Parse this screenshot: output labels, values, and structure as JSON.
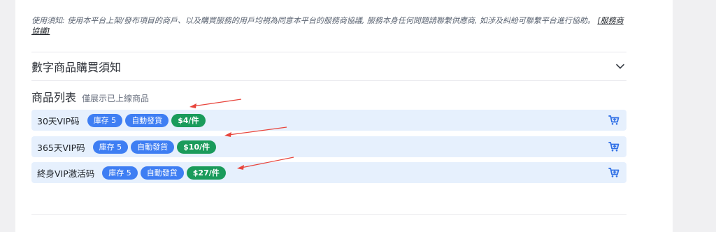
{
  "notice": {
    "text": "使用須知: 使用本平台上架/發布項目的商戶、以及購買服務的用戶均視為同意本平台的服務商協議, 服務本身任何問題請聯繫供應商, 如涉及糾紛可聯繫平台進行協助。",
    "link_label": "[服務商協議]"
  },
  "accordion": {
    "title": "數字商品購買須知",
    "icon": "chevron-down-icon"
  },
  "product_list": {
    "title": "商品列表",
    "subtitle": "僅展示已上線商品",
    "items": [
      {
        "name": "30天VIP码",
        "stock": "庫存 5",
        "delivery": "自動發貨",
        "price": "$4/件"
      },
      {
        "name": "365天VIP码",
        "stock": "庫存 5",
        "delivery": "自動發貨",
        "price": "$10/件"
      },
      {
        "name": "終身VIP激活码",
        "stock": "庫存 5",
        "delivery": "自動發貨",
        "price": "$27/件"
      }
    ],
    "cart_icon": "add-to-cart-icon"
  },
  "colors": {
    "row_bg": "#e6f0fd",
    "badge_blue": "#3e7ef3",
    "badge_green": "#1a9b5b",
    "annotation_arrow": "#e8453c"
  }
}
